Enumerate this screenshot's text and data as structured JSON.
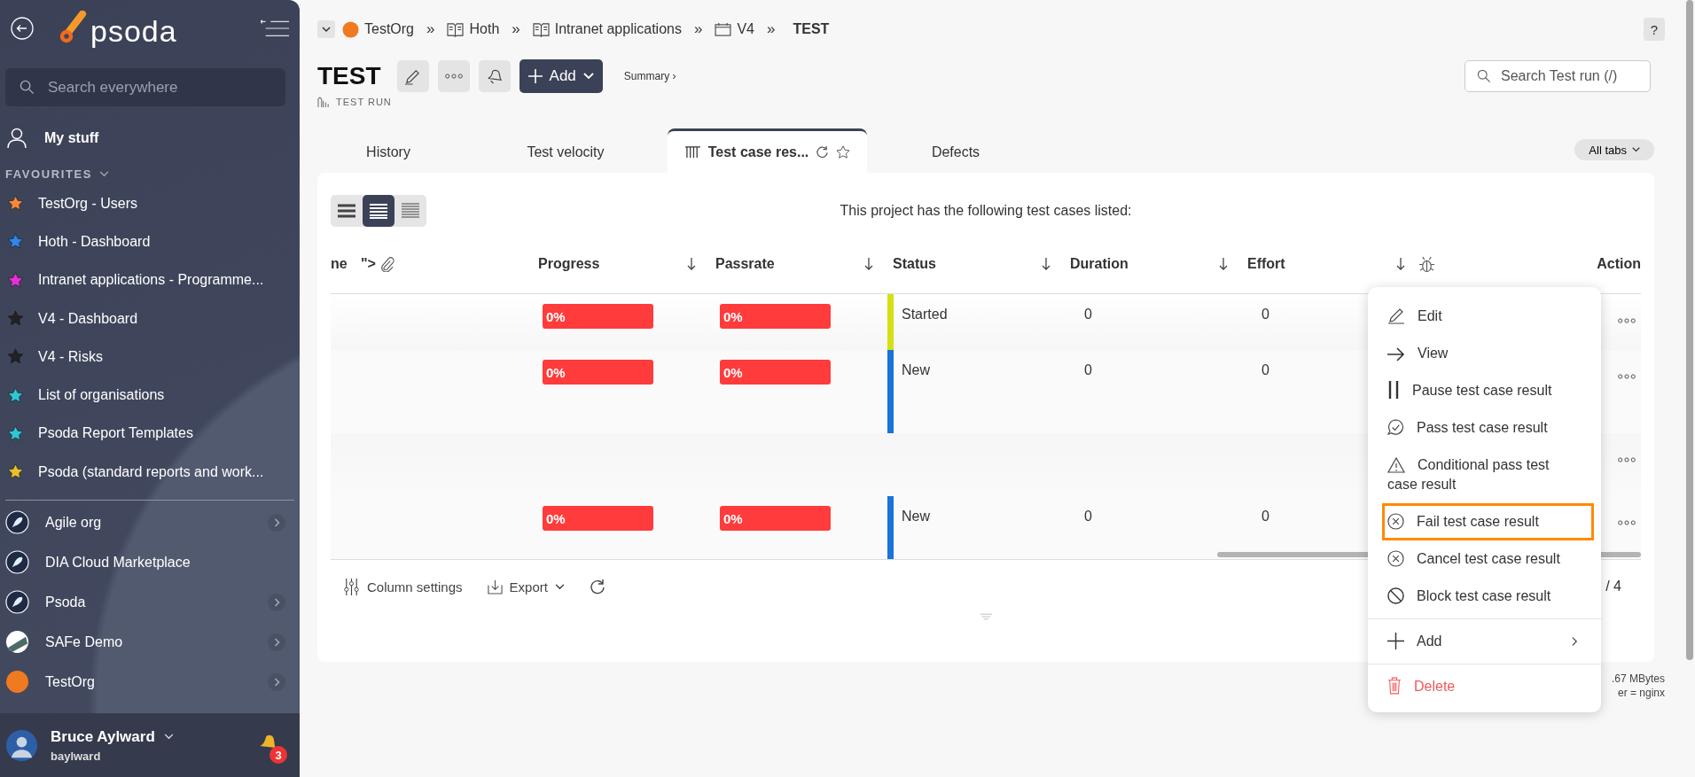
{
  "sidebar": {
    "logo": "psoda",
    "search": {
      "placeholder": "Search everywhere"
    },
    "my_stuff": "My stuff",
    "favourites_heading": "FAVOURITES",
    "favourites": [
      {
        "label": "TestOrg - Users",
        "color": "#f5883a"
      },
      {
        "label": "Hoth - Dashboard",
        "color": "#2f86e8"
      },
      {
        "label": "Intranet applications - Programme...",
        "color": "#e82fd6"
      },
      {
        "label": "V4 - Dashboard",
        "color": "#222222"
      },
      {
        "label": "V4 - Risks",
        "color": "#222222"
      },
      {
        "label": "List of organisations",
        "color": "#2fc6d6"
      },
      {
        "label": "Psoda Report Templates",
        "color": "#2fc6d6"
      },
      {
        "label": "Psoda (standard reports and work...",
        "color": "#e8c02f"
      }
    ],
    "organisations": [
      {
        "label": "Agile org",
        "kind": "rocket",
        "has_submenu": true
      },
      {
        "label": "DIA Cloud Marketplace",
        "kind": "rocket",
        "has_submenu": false
      },
      {
        "label": "Psoda",
        "kind": "rocket",
        "has_submenu": true
      },
      {
        "label": "SAFe Demo",
        "kind": "stripes",
        "has_submenu": true
      },
      {
        "label": "TestOrg",
        "kind": "orange",
        "has_submenu": true
      }
    ],
    "user": {
      "name": "Bruce Aylward",
      "username": "baylward",
      "notifications": "3"
    }
  },
  "breadcrumb": [
    {
      "label": "TestOrg",
      "kind": "org"
    },
    {
      "label": "Hoth",
      "kind": "book",
      "separator": "»"
    },
    {
      "label": "Intranet applications",
      "kind": "book",
      "separator": "»"
    },
    {
      "label": "V4",
      "kind": "board",
      "separator": "»"
    },
    {
      "label": "TEST",
      "kind": "current",
      "separator": "»"
    }
  ],
  "help": "?",
  "page": {
    "title": "TEST",
    "subtitle": "TEST RUN",
    "add_button": "Add",
    "summary_link": "Summary ›",
    "search": {
      "placeholder": "Search Test run (/)"
    }
  },
  "tabs": [
    {
      "label": "History",
      "selected": false
    },
    {
      "label": "Test velocity",
      "selected": false
    },
    {
      "label": "Test case res...",
      "selected": true
    },
    {
      "label": "Defects",
      "selected": false
    }
  ],
  "all_tabs": "All tabs",
  "table": {
    "view_modes": [
      {
        "kind": "comfortable",
        "selected": false
      },
      {
        "kind": "normal",
        "selected": true
      },
      {
        "kind": "compact",
        "selected": false
      }
    ],
    "caption": "This project has the following test cases listed:",
    "columns": [
      {
        "kind": "text",
        "label": "ne",
        "sortable": false
      },
      {
        "kind": "attachment",
        "label": "\">",
        "sortable": false
      },
      {
        "kind": "text",
        "label": "Progress",
        "sortable": true
      },
      {
        "kind": "text",
        "label": "Passrate",
        "sortable": true
      },
      {
        "kind": "text",
        "label": "Status",
        "sortable": true
      },
      {
        "kind": "text",
        "label": "Duration",
        "sortable": true
      },
      {
        "kind": "text",
        "label": "Effort",
        "sortable": true
      },
      {
        "kind": "defects",
        "sortable": false
      },
      {
        "kind": "text",
        "label": "Action",
        "sortable": false
      }
    ],
    "rows": [
      {
        "progress": "0%",
        "passrate": "0%",
        "status": "Started",
        "color": "#d4e014",
        "duration": "0",
        "effort": "0"
      },
      {
        "progress": "0%",
        "passrate": "0%",
        "status": "New",
        "color": "#1a73d9",
        "duration": "0",
        "effort": "0"
      },
      {},
      {
        "progress": "0%",
        "passrate": "0%",
        "status": "New",
        "color": "#1a73d9",
        "duration": "0",
        "effort": "0"
      }
    ]
  },
  "footer": {
    "column_settings": "Column settings",
    "export": "Export",
    "pagination": "/ 4"
  },
  "server_info": [
    ".67 MBytes",
    "er = nginx"
  ],
  "context_menu": {
    "items": [
      {
        "kind": "edit",
        "label": "Edit",
        "highlighted": false
      },
      {
        "kind": "view",
        "label": "View",
        "highlighted": false
      },
      {
        "kind": "pause",
        "label": "Pause test case result",
        "highlighted": false
      },
      {
        "kind": "pass",
        "label": "Pass test case result",
        "highlighted": false
      },
      {
        "kind": "conditional",
        "label": "Conditional pass test case result",
        "highlighted": false
      },
      {
        "kind": "fail",
        "label": "Fail test case result",
        "highlighted": true
      },
      {
        "kind": "cancel",
        "label": "Cancel test case result",
        "highlighted": false
      },
      {
        "kind": "block",
        "label": "Block test case result",
        "highlighted": false
      },
      {
        "kind": "add",
        "label": "Add",
        "highlighted": false
      },
      {
        "kind": "delete",
        "label": "Delete",
        "highlighted": false
      }
    ]
  }
}
